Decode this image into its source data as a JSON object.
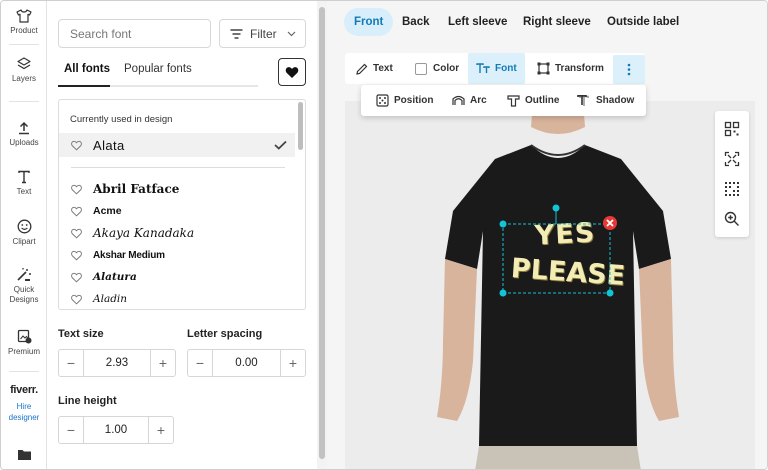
{
  "rail": {
    "items": [
      {
        "label": "Product",
        "icon": "shirt-icon"
      },
      {
        "label": "Layers",
        "icon": "layers-icon"
      },
      {
        "label": "Uploads",
        "icon": "upload-icon"
      },
      {
        "label": "Text",
        "icon": "text-icon"
      },
      {
        "label": "Clipart",
        "icon": "smiley-icon"
      },
      {
        "label": "Quick Designs",
        "icon": "magic-icon"
      },
      {
        "label": "Premium",
        "icon": "premium-icon"
      }
    ],
    "fiverr": {
      "logo": "fiverr.",
      "label": "Hire designer"
    }
  },
  "panel": {
    "search_placeholder": "Search font",
    "filter_label": "Filter",
    "tabs": [
      "All fonts",
      "Popular fonts"
    ],
    "list_heading": "Currently used in design",
    "current_font": "Alata",
    "fonts": [
      "Abril Fatface",
      "Acme",
      "Akaya Kanadaka",
      "Akshar Medium",
      "Alatura",
      "Aladin"
    ],
    "text_size": {
      "label": "Text size",
      "value": "2.93"
    },
    "letter_spacing": {
      "label": "Letter spacing",
      "value": "0.00"
    },
    "line_height": {
      "label": "Line height",
      "value": "1.00"
    }
  },
  "views": [
    "Front",
    "Back",
    "Left sleeve",
    "Right sleeve",
    "Outside label"
  ],
  "toolbar": {
    "items": [
      "Text",
      "Color",
      "Font",
      "Transform"
    ],
    "sub_items": [
      "Position",
      "Arc",
      "Outline",
      "Shadow"
    ]
  },
  "design": {
    "line1": "YES",
    "line2": "PLEASE",
    "text_color": "#f3ecb5",
    "shirt_color": "#1a1a1a",
    "selection_color": "#13c4d6",
    "delete_color": "#e53935"
  },
  "colors": {
    "accent": "#137ab7",
    "accent_bg": "#dcf0fb"
  }
}
